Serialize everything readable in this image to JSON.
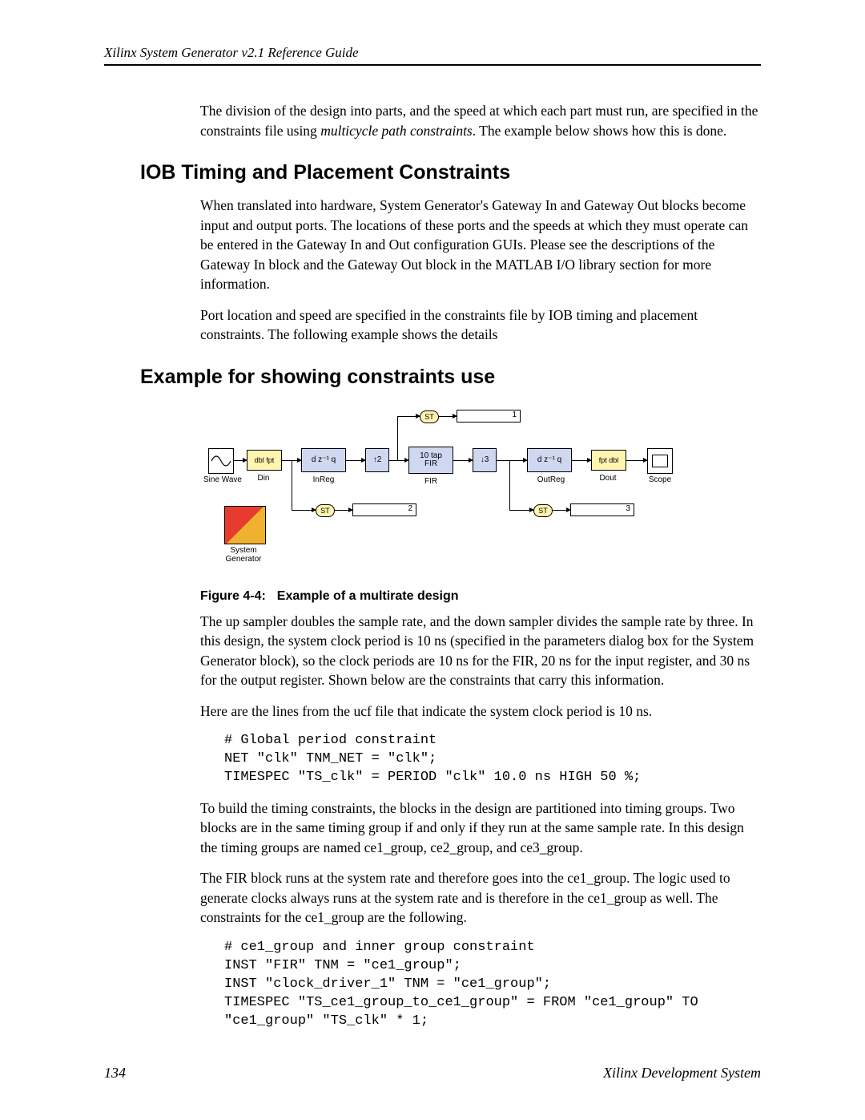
{
  "header": "Xilinx System Generator v2.1 Reference Guide",
  "intro_para": "The division of the design into parts, and the speed at which each part must run, are specified in the constraints file using ",
  "intro_em": "multicycle path constraints",
  "intro_tail": ".  The example below shows how this is done.",
  "h_iob": "IOB Timing and Placement Constraints",
  "iob_p1": "When translated into hardware, System Generator's Gateway In and Gateway Out blocks become input and output ports.  The locations of these ports and the speeds at which they must operate can be entered in the Gateway In and Out configuration GUIs. Please see the descriptions of the Gateway In block and the Gateway Out block in the MATLAB I/O library section for more information.",
  "iob_p2": "Port location and speed are specified in the constraints file by IOB timing and placement constraints. The following example shows the details",
  "h_example": "Example for showing constraints use",
  "figure_label": "Figure 4-4:",
  "figure_caption": "Example of a multirate design",
  "p_upsamp": "The up sampler doubles the sample rate, and the down sampler divides the sample rate by three. In this design, the system clock period is 10 ns (specified in the parameters dialog box for the System Generator block), so the clock periods are 10 ns for the FIR, 20 ns for the input register, and 30 ns for the output register.  Shown below are the constraints that carry this information.",
  "p_ucf": "Here are the lines from the ucf file that indicate the system clock period is 10 ns.",
  "code1": "# Global period constraint\nNET \"clk\" TNM_NET = \"clk\";\nTIMESPEC \"TS_clk\" = PERIOD \"clk\" 10.0 ns HIGH 50 %;",
  "p_build": "To build the timing constraints, the blocks in the design are partitioned into timing groups.  Two blocks are in the same timing group if and only if they run at the same sample rate.  In this design the timing groups are named ce1_group, ce2_group, and ce3_group.",
  "p_fir": "The FIR block runs at the system rate and therefore goes into the ce1_group.  The logic used to generate clocks always runs at the system rate and is therefore in the ce1_group as well.  The constraints for the ce1_group are the following.",
  "code2": "# ce1_group and inner group constraint\nINST \"FIR\" TNM = \"ce1_group\";\nINST \"clock_driver_1\" TNM = \"ce1_group\";\nTIMESPEC \"TS_ce1_group_to_ce1_group\" = FROM \"ce1_group\" TO\n\"ce1_group\" \"TS_clk\" * 1;",
  "footer_page": "134",
  "footer_right": "Xilinx Development System",
  "diagram": {
    "sine": "Sine Wave",
    "din": "Din",
    "dbl_fpt": "dbl fpt",
    "inreg": "InReg",
    "inreg_txt": "d  z⁻¹ q",
    "up": "↑2",
    "fir_top": "10 tap",
    "fir_bot": "FIR",
    "fir_lbl": "FIR",
    "down": "↓3",
    "outreg": "OutReg",
    "outreg_txt": "d  z⁻¹ q",
    "fpt_dbl": "fpt dbl",
    "dout": "Dout",
    "scope": "Scope",
    "st": "ST",
    "sysgen_top": "System",
    "sysgen_bot": "Generator",
    "n1": "1",
    "n2": "2",
    "n3": "3"
  }
}
